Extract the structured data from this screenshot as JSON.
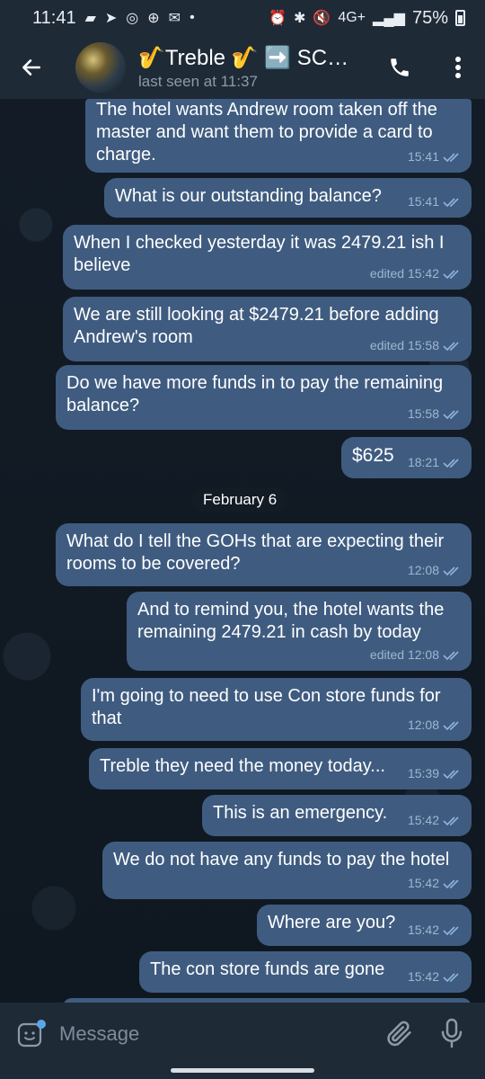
{
  "status_bar": {
    "time": "11:41",
    "network": "4G+",
    "battery": "75%"
  },
  "header": {
    "title": "🎷Treble 🎷 ➡️ SCM...",
    "subtitle": "last seen at 11:37"
  },
  "messages": [
    {
      "text": "The hotel wants Andrew room taken off the master and want them to provide a card to charge.",
      "time": "15:41",
      "edited": false
    },
    {
      "text": "What is our outstanding balance?",
      "time": "15:41",
      "edited": false
    },
    {
      "text": "When I checked yesterday it was 2479.21 ish I believe",
      "time": "edited 15:42",
      "edited": true
    },
    {
      "text": "We are still looking at $2479.21 before adding Andrew's room",
      "time": "edited 15:58",
      "edited": true
    },
    {
      "text": "Do we have more funds in to pay the remaining balance?",
      "time": "15:58",
      "edited": false
    },
    {
      "text": "$625",
      "time": "18:21",
      "edited": false
    },
    {
      "text": "What do I tell the GOHs that are expecting their rooms to be covered?",
      "time": "12:08",
      "edited": false
    },
    {
      "text": "And to remind you, the hotel wants the remaining 2479.21 in cash by today",
      "time": "edited 12:08",
      "edited": true
    },
    {
      "text": "I'm going to need to use Con store funds for that",
      "time": "12:08",
      "edited": false
    },
    {
      "text": "Treble they need the money today...",
      "time": "15:39",
      "edited": false
    },
    {
      "text": "This is an emergency.",
      "time": "15:42",
      "edited": false
    },
    {
      "text": "We do not have any funds to pay the hotel",
      "time": "15:42",
      "edited": false
    },
    {
      "text": "Where are you?",
      "time": "15:42",
      "edited": false
    },
    {
      "text": "The con store funds are gone",
      "time": "15:42",
      "edited": false
    }
  ],
  "date_separator": "February 6",
  "composer": {
    "placeholder": "Message"
  },
  "icons": {
    "back": "arrow-left-icon",
    "call": "phone-icon",
    "menu": "more-vertical-icon",
    "emoji": "sticker-icon",
    "attach": "paperclip-icon",
    "mic": "microphone-icon",
    "read": "double-check-icon"
  },
  "colors": {
    "bubble": "#3f5c80",
    "header": "#1f2a37",
    "background": "#111820",
    "meta": "#9fb6cf"
  }
}
